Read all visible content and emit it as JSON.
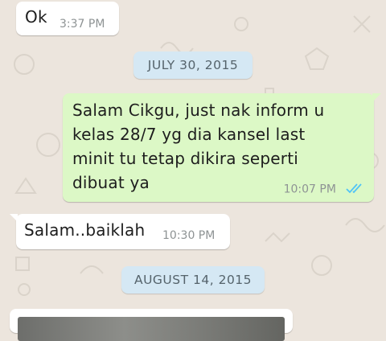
{
  "chat": {
    "messages": [
      {
        "direction": "incoming",
        "text": "Ok",
        "time": "3:37 PM"
      },
      {
        "direction": "outgoing",
        "lines": [
          "Salam Cikgu, just nak inform u",
          "kelas 28/7 yg dia kansel last",
          "minit tu tetap dikira seperti",
          "dibuat ya"
        ],
        "time": "10:07 PM",
        "status": "read",
        "status_icon": "double-check-icon"
      },
      {
        "direction": "incoming",
        "text": "Salam..baiklah",
        "time": "10:30 PM"
      }
    ],
    "date_separators": [
      "JULY 30, 2015",
      "AUGUST 14, 2015"
    ]
  },
  "colors": {
    "wallpaper": "#ece5dd",
    "outgoing_bubble": "#dcf8c6",
    "incoming_bubble": "#ffffff",
    "date_pill": "#d5e8f4",
    "read_ticks": "#4fc3f7",
    "timestamp": "#8e9394"
  }
}
